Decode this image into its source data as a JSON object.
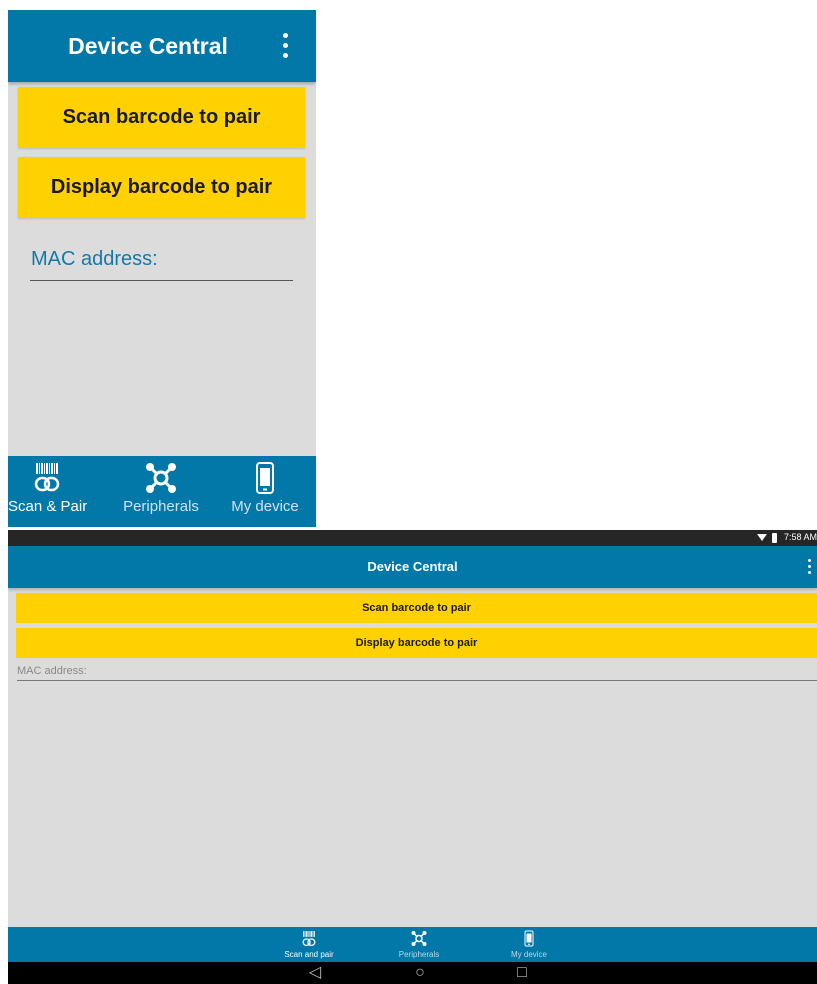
{
  "phone": {
    "title": "Device Central",
    "buttons": {
      "scan": "Scan barcode to pair",
      "display": "Display barcode to pair"
    },
    "mac_placeholder": "MAC address:",
    "nav": [
      {
        "label": "Scan & Pair",
        "icon": "barcode-link-icon"
      },
      {
        "label": "Peripherals",
        "icon": "peripherals-icon"
      },
      {
        "label": "My device",
        "icon": "phone-device-icon"
      }
    ]
  },
  "tablet": {
    "status_time": "7:58 AM",
    "title": "Device Central",
    "buttons": {
      "scan": "Scan barcode to pair",
      "display": "Display barcode to pair"
    },
    "mac_placeholder": "MAC address:",
    "nav": [
      {
        "label": "Scan and pair",
        "icon": "barcode-link-icon"
      },
      {
        "label": "Peripherals",
        "icon": "peripherals-icon"
      },
      {
        "label": "My device",
        "icon": "phone-device-icon"
      }
    ],
    "system_nav": {
      "back": "◁",
      "home": "○",
      "recents": "□"
    }
  },
  "colors": {
    "app_bar": "#0178a8",
    "accent_button": "#ffd100",
    "background": "#dcdcdc",
    "mac_label_phone": "#1479a8"
  }
}
